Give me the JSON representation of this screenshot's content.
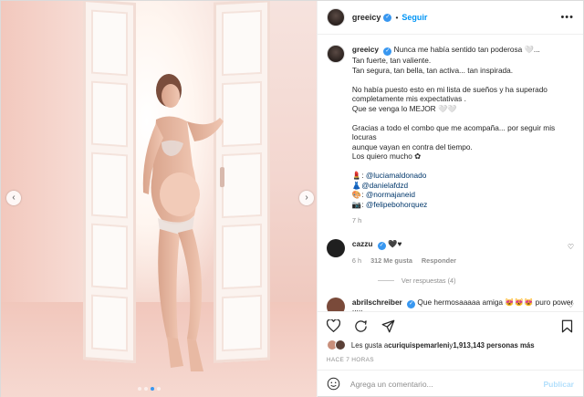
{
  "post": {
    "username": "greeicy",
    "separator": "•",
    "follow_label": "Seguir",
    "more_label": "•••",
    "caption_lines": [
      "Nunca me había sentido tan poderosa 🤍...",
      "Tan fuerte, tan valiente.",
      "Tan segura, tan bella, tan activa... tan inspirada.",
      "",
      "No había puesto esto en mi lista de sueños y ha superado",
      "completamente mis expectativas .",
      "Que se venga lo MEJOR 🤍🤍",
      "",
      "Gracias a todo el combo que me acompaña... por seguir mis locuras",
      "aunque vayan en contra del tiempo.",
      "Los quiero mucho ✿"
    ],
    "credits": [
      {
        "prefix": "💄:",
        "handle": "@luciamaldonado"
      },
      {
        "prefix": "👗",
        "handle": "@danielafdzd"
      },
      {
        "prefix": "🎨:",
        "handle": "@normajaneid"
      },
      {
        "prefix": "📷:",
        "handle": "@felipebohorquez"
      }
    ],
    "caption_time": "7 h"
  },
  "comments": [
    {
      "username": "cazzu",
      "text": "🖤♥",
      "time": "6 h",
      "likes": "312 Me gusta",
      "reply_label": "Responder",
      "avatar_color": "#1f1f1f",
      "view_replies": "Ver respuestas (4)"
    },
    {
      "username": "abrilschreiber",
      "text": "Que hermosaaaaa amiga 😻😻😻 puro power !!!!! ♥♥♥",
      "avatar_color": "#7a4a3a"
    }
  ],
  "actions": {
    "like_icon": "heart-icon",
    "comment_icon": "comment-icon",
    "share_icon": "share-icon",
    "save_icon": "bookmark-icon",
    "likes_prefix": "Les gusta a ",
    "likes_user": "curiquispemarleni",
    "likes_mid": " y ",
    "likes_count": "1,913,143 personas más",
    "time_ago": "HACE 7 HORAS"
  },
  "add_comment": {
    "placeholder": "Agrega un comentario...",
    "publish_label": "Publicar"
  },
  "carousel": {
    "prev_label": "‹",
    "next_label": "›",
    "total": 4,
    "active_index": 2
  },
  "colors": {
    "accent": "#0095f6",
    "verified": "#3897f0",
    "mention": "#00376b",
    "muted": "#8e8e8e"
  }
}
